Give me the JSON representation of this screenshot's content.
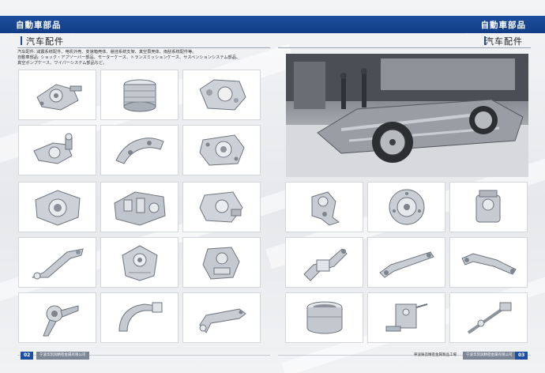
{
  "header": {
    "left_title": "自動車部品",
    "right_title": "自動車部品",
    "left_subtitle": "汽车配件",
    "right_subtitle": "汽车配件"
  },
  "description": [
    "汽车配件: 减震系统配件、电机外壳、变速箱壳体、悬挂系统支架、真空泵壳体、雨刮系统配件等。",
    "自動車部品: ショック・アブソーバー部品、モーターケース、トランスミッションケース、サスペンションシステム部品、",
    "真空ポンプケース、ワイパーシステム部品など。"
  ],
  "left_grid": [
    {
      "icon": "pump-housing-icon"
    },
    {
      "icon": "cylindrical-housing-icon"
    },
    {
      "icon": "engine-cover-icon"
    },
    {
      "icon": "water-pump-housing-icon"
    },
    {
      "icon": "curved-bracket-icon"
    },
    {
      "icon": "oil-pump-cover-icon"
    },
    {
      "icon": "gearbox-cover-icon"
    },
    {
      "icon": "transmission-housing-icon"
    },
    {
      "icon": "motor-end-cover-icon"
    },
    {
      "icon": "suspension-arm-icon"
    },
    {
      "icon": "mounting-bracket-icon"
    },
    {
      "icon": "knuckle-housing-icon"
    },
    {
      "icon": "steering-knuckle-icon"
    },
    {
      "icon": "shift-fork-icon"
    },
    {
      "icon": "lever-bracket-icon"
    }
  ],
  "right_grid": [
    {
      "icon": "elbow-housing-icon"
    },
    {
      "icon": "round-flange-icon"
    },
    {
      "icon": "motor-housing-icon"
    },
    {
      "icon": "engine-mount-icon"
    },
    {
      "icon": "long-bracket-icon"
    },
    {
      "icon": "support-arm-icon"
    },
    {
      "icon": "ring-cylinder-icon"
    },
    {
      "icon": "hinge-bracket-icon"
    },
    {
      "icon": "shaft-lever-icon"
    }
  ],
  "photo": {
    "icon": "car-chassis-photo"
  },
  "footer": {
    "left_page": "02",
    "left_chip": "宁波华凯润精密金属有限公司",
    "right_text": "寧波鋳造精密金属製品工場",
    "right_chip": "宁波华凯润精密金属有限公司",
    "right_page": "03"
  },
  "colors": {
    "brand_blue": "#1d4f9e",
    "metal_light": "#e4e7ea",
    "metal_dark": "#7d848c"
  }
}
